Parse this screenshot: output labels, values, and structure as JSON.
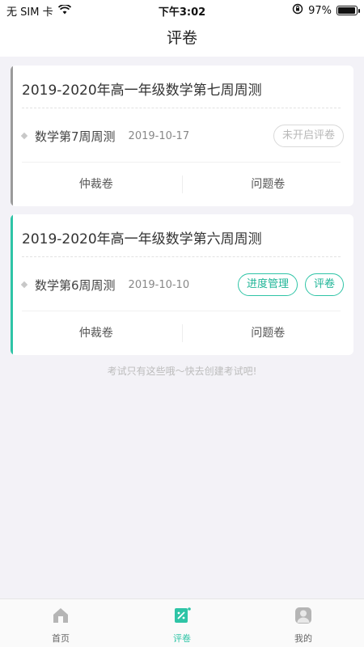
{
  "status_bar": {
    "carrier": "无 SIM 卡",
    "time": "下午3:02",
    "battery": "97%",
    "battery_level": 0.97
  },
  "nav": {
    "title": "评卷"
  },
  "cards": [
    {
      "title": "2019-2020年高一年级数学第七周周测",
      "exam_name": "数学第7周周测",
      "date": "2019-10-17",
      "buttons": [
        "未开启评卷"
      ],
      "button_state": "disabled",
      "accent_color": "#9a9a9a",
      "actions": [
        "仲裁卷",
        "问题卷"
      ]
    },
    {
      "title": "2019-2020年高一年级数学第六周周测",
      "exam_name": "数学第6周周测",
      "date": "2019-10-10",
      "buttons": [
        "进度管理",
        "评卷"
      ],
      "button_state": "active",
      "accent_color": "#2ec4a6",
      "actions": [
        "仲裁卷",
        "问题卷"
      ]
    }
  ],
  "hint": "考试只有这些哦～快去创建考试吧!",
  "tabs": [
    {
      "label": "首页",
      "icon": "home-icon",
      "active": false
    },
    {
      "label": "评卷",
      "icon": "grading-icon",
      "active": true
    },
    {
      "label": "我的",
      "icon": "profile-icon",
      "active": false
    }
  ],
  "colors": {
    "accent": "#2ec4a6",
    "background": "#f3f2f7",
    "disabled": "#b8b8b8"
  }
}
